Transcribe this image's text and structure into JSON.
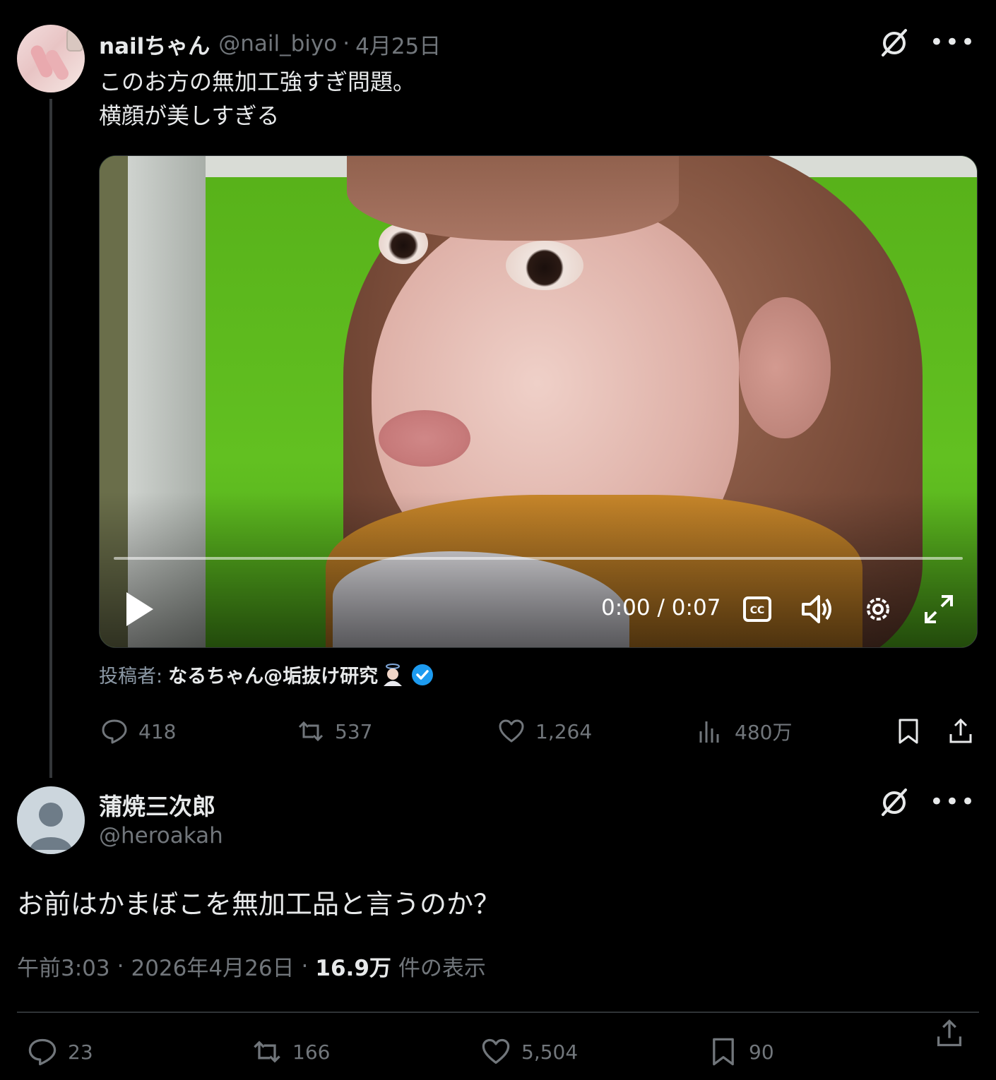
{
  "quoted_tweet": {
    "display_name": "nailちゃん",
    "handle": "@nail_biyo",
    "date": "4月25日",
    "separator": "·",
    "text_lines": [
      "このお方の無加工強すぎ問題。",
      "横顔が美しすぎる"
    ],
    "video": {
      "current_time": "0:00",
      "duration": "0:07",
      "time_separator": "/",
      "progress_fraction": 0
    },
    "posted_by_label": "投稿者:",
    "posted_by_name": "なるちゃん@垢抜け研究",
    "actions": {
      "replies": "418",
      "retweets": "537",
      "likes": "1,264",
      "views": "480万"
    }
  },
  "main_tweet": {
    "display_name": "蒲焼三次郎",
    "handle": "@heroakah",
    "text": "お前はかまぼこを無加工品と言うのか？",
    "time": "午前3:03",
    "date": "2026年4月26日",
    "separator": "·",
    "views_count": "16.9万",
    "views_label": "件の表示",
    "actions": {
      "replies": "23",
      "retweets": "166",
      "likes": "5,504",
      "bookmarks": "90"
    }
  },
  "colors": {
    "background": "#000000",
    "text_primary": "#e7e9ea",
    "text_secondary": "#71767b",
    "verified_blue": "#1d9bf0",
    "divider": "#2f3336"
  },
  "icons": [
    "grok-icon",
    "more-icon",
    "play-icon",
    "captions-icon",
    "volume-icon",
    "settings-icon",
    "fullscreen-icon",
    "reply-icon",
    "retweet-icon",
    "like-icon",
    "views-icon",
    "bookmark-icon",
    "share-icon",
    "verified-badge-icon",
    "angel-emoji-icon"
  ]
}
